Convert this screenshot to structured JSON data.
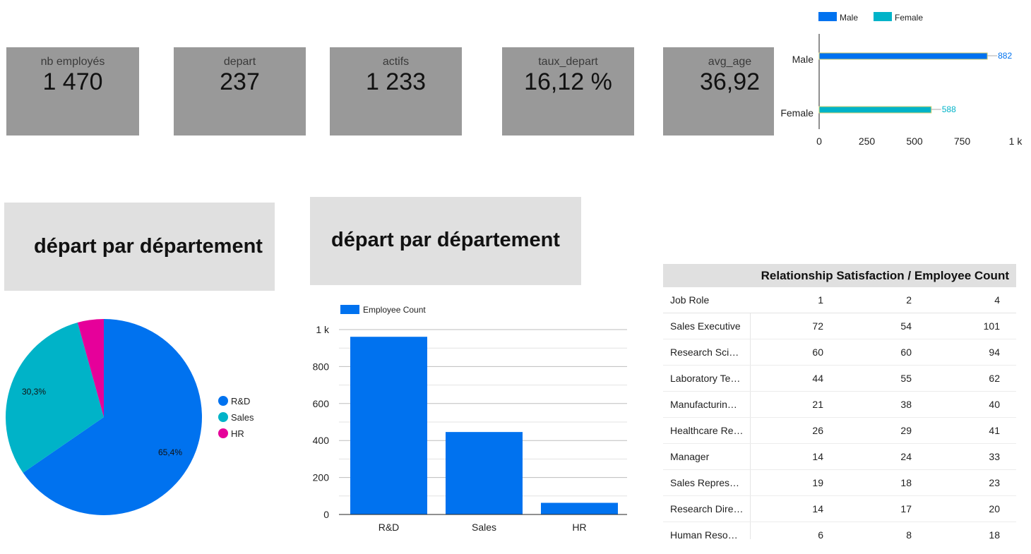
{
  "kpis": [
    {
      "label": "nb employés",
      "value": "1 470"
    },
    {
      "label": "depart",
      "value": "237"
    },
    {
      "label": "actifs",
      "value": "1 233"
    },
    {
      "label": "taux_depart",
      "value": "16,12 %"
    },
    {
      "label": "avg_age",
      "value": "36,92"
    }
  ],
  "titles": {
    "left": "départ par département",
    "middle": "départ par département"
  },
  "colors": {
    "blue": "#0072ef",
    "teal": "#00b3c8",
    "pink": "#e6009a",
    "kpi_bg": "#999999",
    "title_bg": "#e0e0e0"
  },
  "chart_data": [
    {
      "type": "bar",
      "orientation": "horizontal",
      "categories": [
        "Male",
        "Female"
      ],
      "series": [
        {
          "name": "Male",
          "values": [
            882,
            null
          ]
        },
        {
          "name": "Female",
          "values": [
            null,
            588
          ]
        }
      ],
      "data_labels": [
        "882",
        "588"
      ],
      "x_ticks": [
        "0",
        "250",
        "500",
        "750",
        "1 k"
      ],
      "xlim": [
        0,
        1000
      ],
      "legend": "top"
    },
    {
      "type": "pie",
      "labels": [
        "R&D",
        "Sales",
        "HR"
      ],
      "values": [
        65.4,
        30.3,
        4.3
      ],
      "slice_labels": [
        "65,4%",
        "30,3%",
        ""
      ],
      "legend": "right"
    },
    {
      "type": "bar",
      "categories": [
        "R&D",
        "Sales",
        "HR"
      ],
      "series": [
        {
          "name": "Employee Count",
          "values": [
            961,
            446,
            63
          ]
        }
      ],
      "y_ticks": [
        "0",
        "200",
        "400",
        "600",
        "800",
        "1 k"
      ],
      "ylim": [
        0,
        1000
      ],
      "legend": "top-left"
    },
    {
      "type": "table",
      "title": "Relationship Satisfaction / Employee Count",
      "columns": [
        "Job Role",
        "1",
        "2",
        "4"
      ],
      "rows": [
        [
          "Sales Executive",
          "72",
          "54",
          "101"
        ],
        [
          "Research Sci…",
          "60",
          "60",
          "94"
        ],
        [
          "Laboratory Te…",
          "44",
          "55",
          "62"
        ],
        [
          "Manufacturin…",
          "21",
          "38",
          "40"
        ],
        [
          "Healthcare Re…",
          "26",
          "29",
          "41"
        ],
        [
          "Manager",
          "14",
          "24",
          "33"
        ],
        [
          "Sales Repres…",
          "19",
          "18",
          "23"
        ],
        [
          "Research Dire…",
          "14",
          "17",
          "20"
        ],
        [
          "Human Reso…",
          "6",
          "8",
          "18"
        ]
      ]
    }
  ]
}
